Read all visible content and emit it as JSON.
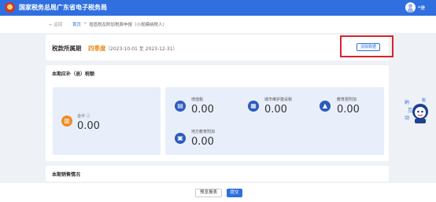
{
  "header": {
    "site_title": "国家税务总局广东省电子税务局",
    "user_name": "*捷"
  },
  "breadcrumb": {
    "back": "← 返回",
    "home": "首页",
    "separator": ">",
    "current": "增值税及附加税费申报（小规模纳税人）"
  },
  "period": {
    "label": "税款所属期",
    "quarter": "四季度",
    "range": "（2023-10-01 至 2023-12-31）",
    "clear_button": "清除数据"
  },
  "tax": {
    "section_title": "本期应补（退）税额",
    "total": {
      "label": "合计 ⓘ",
      "value": "0.00"
    },
    "items": [
      {
        "label": "增值税",
        "value": "0.00"
      },
      {
        "label": "城市维护建设税",
        "value": "0.00"
      },
      {
        "label": "教育费附加",
        "value": "0.00"
      },
      {
        "label": "地方教育附加",
        "value": "0.00"
      }
    ]
  },
  "sales": {
    "section_title": "本期销售情况"
  },
  "footer": {
    "preview_button": "预览报表",
    "submit_button": "提交"
  },
  "colors": {
    "primary": "#2f6fdf",
    "highlight_box": "#d9232e",
    "total_icon": "#ef8a26",
    "item_icon": "#2c5bbf"
  },
  "icons": [
    "emblem-icon",
    "avatar-icon",
    "chart-icon",
    "ledger-icon",
    "building-icon",
    "graduation-cap-icon",
    "book-icon",
    "assistant-mascot-icon"
  ]
}
